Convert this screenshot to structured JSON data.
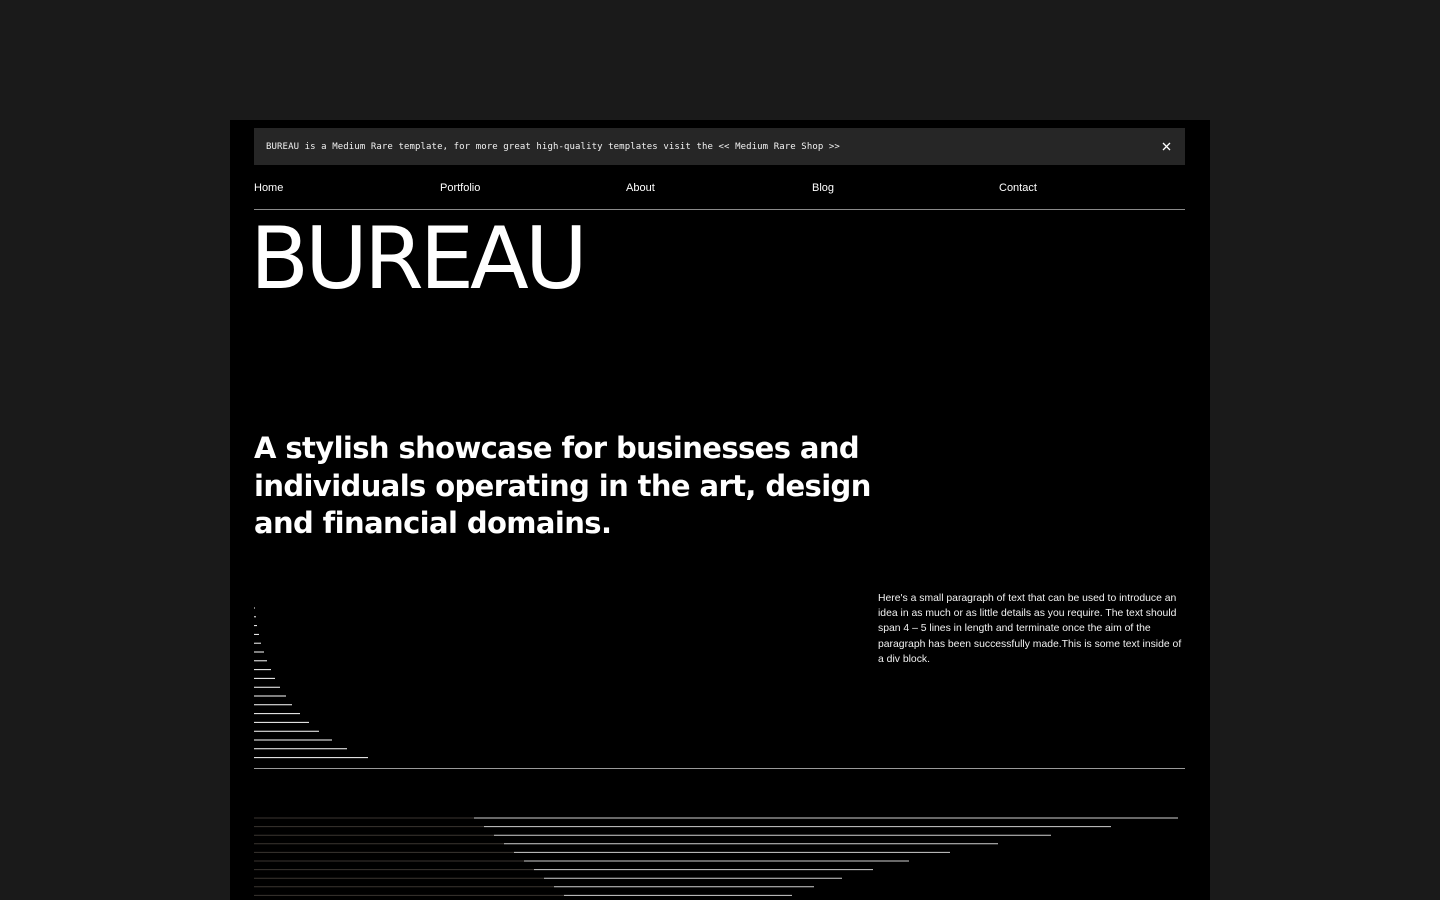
{
  "banner": {
    "text": "BUREAU is a Medium Rare template, for more great high-quality templates visit the",
    "link_label": "<< Medium Rare Shop >>",
    "close_icon": "close-icon"
  },
  "nav": {
    "items": [
      {
        "label": "Home"
      },
      {
        "label": "Portfolio"
      },
      {
        "label": "About"
      },
      {
        "label": "Blog"
      },
      {
        "label": "Contact"
      }
    ]
  },
  "hero": {
    "logo": "BUREAU",
    "headline": "A stylish showcase for businesses and individuals operating in the art, design and financial domains.",
    "paragraph": "Here's a small paragraph of text that can be used to introduce an idea in as much or as little details as you require. The text should span 4 – 5 lines in length and terminate once the aim of the paragraph has been successfully made.This is some text inside of a div block."
  },
  "colors": {
    "page_background": "#1a1a1a",
    "frame_background": "#000000",
    "banner_background": "#262626",
    "text": "#ffffff",
    "rule": "#9a9a9a"
  }
}
